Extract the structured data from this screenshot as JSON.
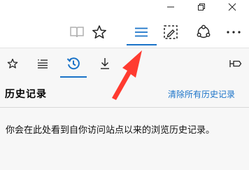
{
  "window_controls": {
    "minimize_icon": "minimize-icon",
    "restore_icon": "restore-icon",
    "close_icon": "close-icon"
  },
  "toolbar": {
    "icons": [
      "reading-view-icon",
      "favorites-star-icon",
      "hub-icon",
      "web-note-icon",
      "share-icon",
      "more-icon"
    ],
    "active": "hub-icon",
    "accent": "#1a73c8"
  },
  "hub_tabs": {
    "icons": [
      "favorites-tab-icon",
      "reading-list-tab-icon",
      "history-tab-icon",
      "downloads-tab-icon",
      "pin-pane-icon"
    ],
    "active": "history-tab-icon"
  },
  "history_panel": {
    "title": "历史记录",
    "clear_link": "清除所有历史记录",
    "empty_message": "你会在此处看到自你访问站点以来的浏览历史记录。"
  },
  "annotation": {
    "color": "#ff3b30"
  }
}
